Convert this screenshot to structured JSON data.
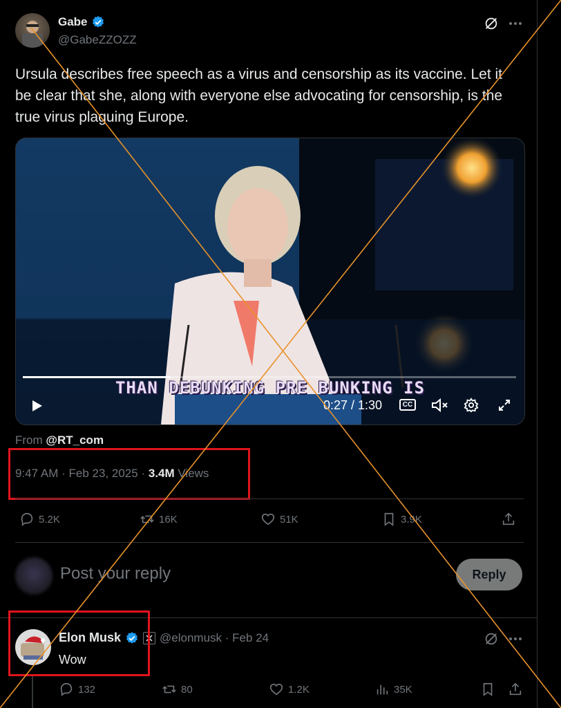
{
  "tweet": {
    "author_name": "Gabe",
    "author_handle": "@GabeZZOZZ",
    "text": "Ursula describes free speech as a virus and censorship as its vaccine. Let it be clear that she, along with everyone else advocating for censorship, is the true virus plaguing Europe.",
    "from_prefix": "From",
    "from_source": "@RT_com",
    "time": "9:47 AM",
    "date": "Feb 23, 2025",
    "separator": "·",
    "views_count": "3.4M",
    "views_label": "Views"
  },
  "video": {
    "caption": "THAN DEBUNKING PRE BUNKING IS",
    "timestamp": "0:27 / 1:30",
    "progress": 0.3,
    "cc_label": "CC"
  },
  "actions": {
    "replies": "5.2K",
    "reposts": "16K",
    "likes": "51K",
    "bookmarks": "3.9K"
  },
  "composer": {
    "placeholder": "Post your reply",
    "reply_button": "Reply"
  },
  "reply": {
    "author_name": "Elon Musk",
    "author_handle": "@elonmusk",
    "separator": "·",
    "date": "Feb 24",
    "text": "Wow",
    "replies": "132",
    "reposts": "80",
    "likes": "1.2K",
    "views": "35K"
  },
  "colors": {
    "background": "#000000",
    "text": "#e7e9ea",
    "muted": "#71767b",
    "verified": "#1d9bf0",
    "annotation_box": "#e0141e",
    "cross_lines": "#e8922a"
  }
}
